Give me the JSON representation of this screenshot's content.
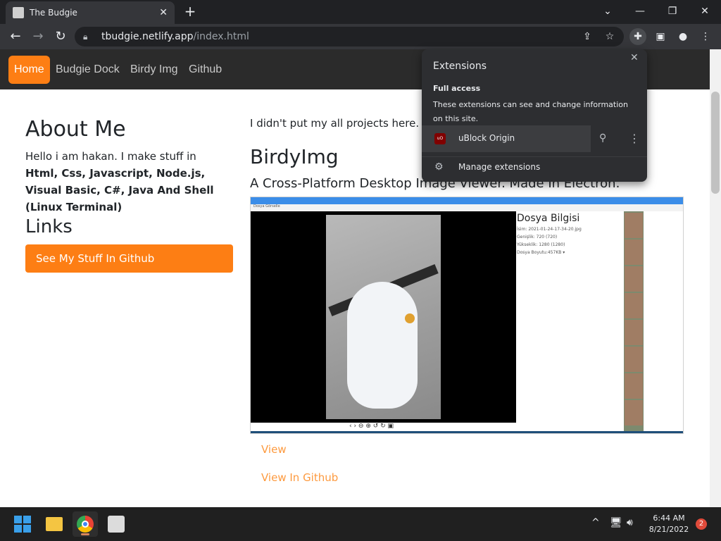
{
  "browser": {
    "tab_title": "The Budgie",
    "tab_close": "✕",
    "new_tab": "+",
    "url_host": "tbudgie.netlify.app",
    "url_path": "/index.html"
  },
  "site": {
    "nav": [
      "Home",
      "Budgie Dock",
      "Birdy Img",
      "Github"
    ],
    "about_title": "About Me",
    "about_plain": "Hello i am hakan. I make stuff in ",
    "about_bold": "Html, Css, Javascript, Node.js, Visual Basic, C#, Java And Shell (Linux Terminal)",
    "links_title": "Links",
    "github_button": "See My Stuff In Github",
    "intro": "I didn't put my all projects here. Yo",
    "project_title": "BirdyImg",
    "project_subtitle": "A Cross-Platform Desktop Image Viewer. Made In Electron.",
    "link_view": "View",
    "link_github": "View In Github",
    "shot": {
      "menu": "Dosya  Görselle",
      "info_title": "Dosya Bilgisi",
      "info_lines": [
        "İsim: 2021-01-24-17-34-20.jpg",
        "Genişlik: 720 (720)",
        "Yükseklik: 1280 (1280)",
        "Dosya Boyutu:457KB ▾"
      ],
      "controls": "‹ ›  ⊖ ⊕  ↺ ↻  ▣"
    }
  },
  "extensions_popup": {
    "title": "Extensions",
    "close": "✕",
    "full_access": "Full access",
    "description": "These extensions can see and change information on this site.",
    "extension_name": "uBlock Origin",
    "extension_badge": "uO",
    "manage": "Manage extensions"
  },
  "taskbar": {
    "time": "6:44 AM",
    "date": "8/21/2022",
    "notifications": "2"
  },
  "icons": {
    "back": "back-icon",
    "forward": "forward-icon",
    "reload": "reload-icon",
    "share": "share-icon",
    "bookmark": "star-icon",
    "extensions": "puzzle-icon",
    "sidepanel": "side-panel-icon",
    "profile": "profile-icon",
    "menu": "kebab-icon"
  },
  "colors": {
    "accent": "#fd7e14",
    "link": "#fd9a3f",
    "navbar": "#2b2b2b"
  }
}
